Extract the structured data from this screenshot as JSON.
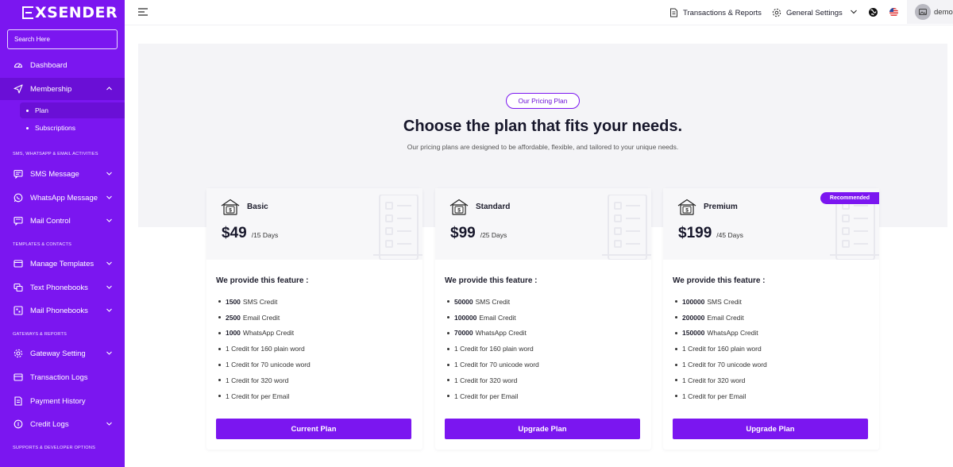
{
  "brand": {
    "name": "XSENDER"
  },
  "sidebar": {
    "search_placeholder": "Search Here",
    "items": [
      {
        "label": "Dashboard",
        "icon": "dashboard-icon"
      },
      {
        "label": "Membership",
        "icon": "send-icon",
        "expanded": true,
        "children": [
          {
            "label": "Plan",
            "active": true
          },
          {
            "label": "Subscriptions"
          }
        ]
      },
      {
        "label": "SMS Message",
        "icon": "sms-icon"
      },
      {
        "label": "WhatsApp Message",
        "icon": "whatsapp-icon"
      },
      {
        "label": "Mail Control",
        "icon": "mail-icon"
      },
      {
        "label": "Manage Templates",
        "icon": "template-icon"
      },
      {
        "label": "Text Phonebooks",
        "icon": "phonebook-icon"
      },
      {
        "label": "Mail Phonebooks",
        "icon": "mail-phonebook-icon"
      },
      {
        "label": "Gateway Setting",
        "icon": "gear-icon"
      },
      {
        "label": "Transaction Logs",
        "icon": "receipt-icon"
      },
      {
        "label": "Payment History",
        "icon": "document-icon"
      },
      {
        "label": "Credit Logs",
        "icon": "coins-icon"
      }
    ],
    "sections": [
      "SMS, WHATSAPP & EMAIL ACTIVITIES",
      "TEMPLATES & CONTACTS",
      "GATEWAYS & REPORTS",
      "SUPPORTS & DEVELOPER OPTIONS"
    ]
  },
  "topbar": {
    "transactions_label": "Transactions & Reports",
    "settings_label": "General Settings",
    "user_name": "demo"
  },
  "hero": {
    "pill": "Our Pricing Plan",
    "title": "Choose the plan that fits your needs.",
    "subtitle": "Our pricing plans are designed to be affordable, flexible, and tailored to your unique needs."
  },
  "features_title": "We provide this feature :",
  "plans": [
    {
      "name": "Basic",
      "price": "$49",
      "period": "/15 Days",
      "features": [
        {
          "strong": "1500",
          "text": "SMS Credit"
        },
        {
          "strong": "2500",
          "text": "Email Credit"
        },
        {
          "strong": "1000",
          "text": "WhatsApp Credit"
        },
        {
          "strong": "",
          "text": "1 Credit for 160 plain word"
        },
        {
          "strong": "",
          "text": "1 Credit for 70 unicode word"
        },
        {
          "strong": "",
          "text": "1 Credit for 320 word"
        },
        {
          "strong": "",
          "text": "1 Credit for per Email"
        }
      ],
      "button": "Current Plan",
      "badge": ""
    },
    {
      "name": "Standard",
      "price": "$99",
      "period": "/25 Days",
      "features": [
        {
          "strong": "50000",
          "text": "SMS Credit"
        },
        {
          "strong": "100000",
          "text": "Email Credit"
        },
        {
          "strong": "70000",
          "text": "WhatsApp Credit"
        },
        {
          "strong": "",
          "text": "1 Credit for 160 plain word"
        },
        {
          "strong": "",
          "text": "1 Credit for 70 unicode word"
        },
        {
          "strong": "",
          "text": "1 Credit for 320 word"
        },
        {
          "strong": "",
          "text": "1 Credit for per Email"
        }
      ],
      "button": "Upgrade Plan",
      "badge": ""
    },
    {
      "name": "Premium",
      "price": "$199",
      "period": "/45 Days",
      "features": [
        {
          "strong": "100000",
          "text": "SMS Credit"
        },
        {
          "strong": "200000",
          "text": "Email Credit"
        },
        {
          "strong": "150000",
          "text": "WhatsApp Credit"
        },
        {
          "strong": "",
          "text": "1 Credit for 160 plain word"
        },
        {
          "strong": "",
          "text": "1 Credit for 70 unicode word"
        },
        {
          "strong": "",
          "text": "1 Credit for 320 word"
        },
        {
          "strong": "",
          "text": "1 Credit for per Email"
        }
      ],
      "button": "Upgrade Plan",
      "badge": "Recommended"
    }
  ],
  "colors": {
    "accent": "#7b16f0",
    "accent_dark": "#6a0fd6",
    "hero_bg": "#f4f4f7"
  }
}
